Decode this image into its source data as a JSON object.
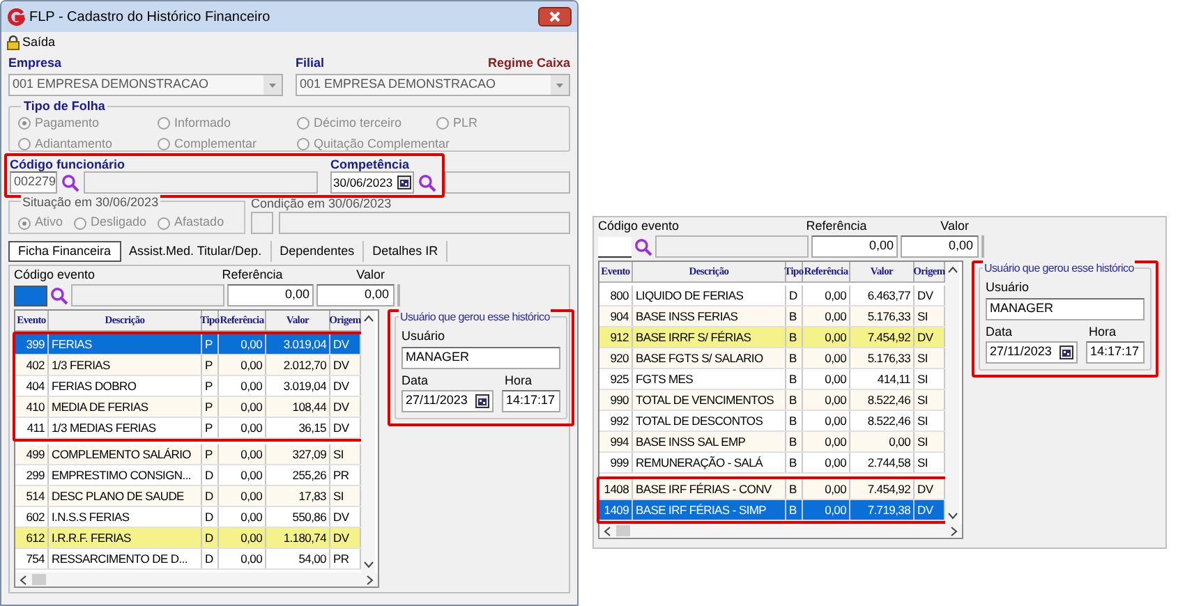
{
  "window": {
    "title": "FLP - Cadastro do Histórico Financeiro"
  },
  "menu": [
    {
      "label": "Saída"
    }
  ],
  "empresa": {
    "label": "Empresa",
    "value": "001 EMPRESA DEMONSTRACAO"
  },
  "filial": {
    "label": "Filial",
    "value": "001 EMPRESA DEMONSTRACAO"
  },
  "regime": "Regime Caixa",
  "tipo_de_folha": {
    "title": "Tipo de Folha",
    "options": [
      {
        "label": "Pagamento",
        "selected": true
      },
      {
        "label": "Informado",
        "selected": false
      },
      {
        "label": "Décimo terceiro",
        "selected": false
      },
      {
        "label": "PLR",
        "selected": false
      },
      {
        "label": "Adiantamento",
        "selected": false
      },
      {
        "label": "Complementar",
        "selected": false
      },
      {
        "label": "Quitação Complementar",
        "selected": false
      }
    ]
  },
  "funcionario": {
    "label": "Código funcionário",
    "code": "002279",
    "annotated": true
  },
  "competencia": {
    "label": "Competência",
    "value": "30/06/2023"
  },
  "situacao": {
    "label": "Situação em 30/06/2023",
    "options": [
      {
        "label": "Ativo",
        "selected": true
      },
      {
        "label": "Desligado",
        "selected": false
      },
      {
        "label": "Afastado",
        "selected": false
      }
    ]
  },
  "condicao": {
    "label": "Condição em 30/06/2023"
  },
  "tabs": [
    {
      "label": "Ficha Financeira",
      "selected": true
    },
    {
      "label": "Assist.Med. Titular/Dep.",
      "selected": false
    },
    {
      "label": "Dependentes",
      "selected": false
    },
    {
      "label": "Detalhes IR",
      "selected": false
    }
  ],
  "ficha": {
    "evento_form": {
      "codigo_label": "Código evento",
      "focused": true,
      "referencia_label": "Referência",
      "referencia": "0,00",
      "valor_label": "Valor",
      "valor": "0,00"
    },
    "grid": {
      "columns": [
        "Evento",
        "Descrição",
        "Tipo",
        "Referência",
        "Valor",
        "Origem"
      ],
      "rows": [
        {
          "evento": "399",
          "descricao": "FERIAS",
          "tipo": "P",
          "referencia": "0,00",
          "valor": "3.019,04",
          "origem": "DV",
          "selected": true,
          "flagged": false,
          "annotated": true
        },
        {
          "evento": "402",
          "descricao": "1/3 FERIAS",
          "tipo": "P",
          "referencia": "0,00",
          "valor": "2.012,70",
          "origem": "DV",
          "selected": false,
          "flagged": false,
          "annotated": true
        },
        {
          "evento": "404",
          "descricao": "FERIAS DOBRO",
          "tipo": "P",
          "referencia": "0,00",
          "valor": "3.019,04",
          "origem": "DV",
          "selected": false,
          "flagged": false,
          "annotated": true
        },
        {
          "evento": "410",
          "descricao": "MEDIA DE FERIAS",
          "tipo": "P",
          "referencia": "0,00",
          "valor": "108,44",
          "origem": "DV",
          "selected": false,
          "flagged": false,
          "annotated": true
        },
        {
          "evento": "411",
          "descricao": "1/3 MEDIAS FERIAS",
          "tipo": "P",
          "referencia": "0,00",
          "valor": "36,15",
          "origem": "DV",
          "selected": false,
          "flagged": false,
          "annotated": true
        },
        {
          "evento": "499",
          "descricao": "COMPLEMENTO SALÁRIO",
          "tipo": "P",
          "referencia": "0,00",
          "valor": "327,09",
          "origem": "SI",
          "selected": false,
          "flagged": false,
          "annotated": false
        },
        {
          "evento": "299",
          "descricao": "EMPRESTIMO CONSIGN...",
          "tipo": "D",
          "referencia": "0,00",
          "valor": "255,26",
          "origem": "PR",
          "selected": false,
          "flagged": false,
          "annotated": false
        },
        {
          "evento": "514",
          "descricao": "DESC PLANO DE SAUDE",
          "tipo": "D",
          "referencia": "0,00",
          "valor": "17,83",
          "origem": "SI",
          "selected": false,
          "flagged": false,
          "annotated": false
        },
        {
          "evento": "602",
          "descricao": "I.N.S.S FERIAS",
          "tipo": "D",
          "referencia": "0,00",
          "valor": "550,86",
          "origem": "DV",
          "selected": false,
          "flagged": false,
          "annotated": false
        },
        {
          "evento": "612",
          "descricao": "I.R.R.F. FERIAS",
          "tipo": "D",
          "referencia": "0,00",
          "valor": "1.180,74",
          "origem": "DV",
          "selected": false,
          "flagged": true,
          "annotated": false
        },
        {
          "evento": "754",
          "descricao": "RESSARCIMENTO DE D...",
          "tipo": "D",
          "referencia": "0,00",
          "valor": "54,00",
          "origem": "PR",
          "selected": false,
          "flagged": false,
          "annotated": false
        }
      ]
    },
    "usuario_box": {
      "title": "Usuário que gerou esse histórico",
      "usuario_label": "Usuário",
      "usuario": "MANAGER",
      "data_label": "Data",
      "data": "27/11/2023",
      "hora_label": "Hora",
      "hora": "14:17:17",
      "annotated": true
    }
  },
  "zoom_panel": {
    "evento_form": {
      "codigo_label": "Código evento",
      "focused": false,
      "referencia_label": "Referência",
      "referencia": "0,00",
      "valor_label": "Valor",
      "valor": "0,00"
    },
    "grid": {
      "columns": [
        "Evento",
        "Descrição",
        "Tipo",
        "Referência",
        "Valor",
        "Origem"
      ],
      "rows": [
        {
          "evento": "800",
          "descricao": "LIQUIDO DE FERIAS",
          "tipo": "D",
          "referencia": "0,00",
          "valor": "6.463,77",
          "origem": "DV",
          "selected": false,
          "flagged": false,
          "annotated": false
        },
        {
          "evento": "904",
          "descricao": "BASE INSS FERIAS",
          "tipo": "B",
          "referencia": "0,00",
          "valor": "5.176,33",
          "origem": "SI",
          "selected": false,
          "flagged": false,
          "annotated": false
        },
        {
          "evento": "912",
          "descricao": "BASE IRRF S/ FÉRIAS",
          "tipo": "B",
          "referencia": "0,00",
          "valor": "7.454,92",
          "origem": "DV",
          "selected": false,
          "flagged": true,
          "annotated": false
        },
        {
          "evento": "920",
          "descricao": "BASE FGTS S/ SALARIO",
          "tipo": "B",
          "referencia": "0,00",
          "valor": "5.176,33",
          "origem": "SI",
          "selected": false,
          "flagged": false,
          "annotated": false
        },
        {
          "evento": "925",
          "descricao": "FGTS MES",
          "tipo": "B",
          "referencia": "0,00",
          "valor": "414,11",
          "origem": "SI",
          "selected": false,
          "flagged": false,
          "annotated": false
        },
        {
          "evento": "990",
          "descricao": "TOTAL DE VENCIMENTOS",
          "tipo": "B",
          "referencia": "0,00",
          "valor": "8.522,46",
          "origem": "SI",
          "selected": false,
          "flagged": false,
          "annotated": false
        },
        {
          "evento": "992",
          "descricao": "TOTAL DE DESCONTOS",
          "tipo": "B",
          "referencia": "0,00",
          "valor": "8.522,46",
          "origem": "SI",
          "selected": false,
          "flagged": false,
          "annotated": false
        },
        {
          "evento": "994",
          "descricao": "BASE INSS SAL EMP",
          "tipo": "B",
          "referencia": "0,00",
          "valor": "0,00",
          "origem": "SI",
          "selected": false,
          "flagged": false,
          "annotated": false
        },
        {
          "evento": "999",
          "descricao": "REMUNERAÇÃO - SALÁ",
          "tipo": "B",
          "referencia": "0,00",
          "valor": "2.744,58",
          "origem": "SI",
          "selected": false,
          "flagged": false,
          "annotated": false
        },
        {
          "evento": "1408",
          "descricao": "BASE IRF FÉRIAS - CONV",
          "tipo": "B",
          "referencia": "0,00",
          "valor": "7.454,92",
          "origem": "DV",
          "selected": false,
          "flagged": false,
          "annotated": true
        },
        {
          "evento": "1409",
          "descricao": "BASE IRF FÉRIAS - SIMP",
          "tipo": "B",
          "referencia": "0,00",
          "valor": "7.719,38",
          "origem": "DV",
          "selected": true,
          "flagged": false,
          "annotated": true
        }
      ]
    },
    "usuario_box": {
      "title": "Usuário que gerou esse histórico",
      "usuario_label": "Usuário",
      "usuario": "MANAGER",
      "data_label": "Data",
      "data": "27/11/2023",
      "hora_label": "Hora",
      "hora": "14:17:17",
      "annotated": true
    }
  }
}
